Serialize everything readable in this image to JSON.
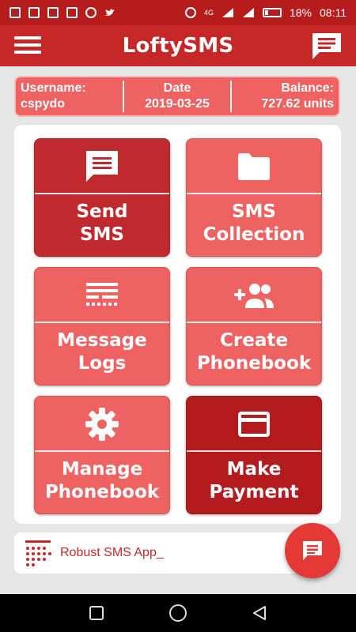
{
  "status_bar": {
    "battery": "18%",
    "time": "08:11",
    "network": "4G"
  },
  "app_bar": {
    "title": "LoftySMS",
    "menu_icon": "hamburger-menu-icon",
    "chat_icon": "chat-icon"
  },
  "info": {
    "username_label": "Username:",
    "username": "cspydo",
    "date_label": "Date",
    "date": "2019-03-25",
    "balance_label": "Balance:",
    "balance": "727.62 units"
  },
  "tiles": [
    {
      "line1": "Send",
      "line2": "SMS",
      "icon": "message-icon"
    },
    {
      "line1": "SMS",
      "line2": "Collection",
      "icon": "folder-icon"
    },
    {
      "line1": "Message",
      "line2": "Logs",
      "icon": "logs-icon"
    },
    {
      "line1": "Create",
      "line2": "Phonebook",
      "icon": "add-group-icon"
    },
    {
      "line1": "Manage",
      "line2": "Phonebook",
      "icon": "settings-gear-icon"
    },
    {
      "line1": "Make",
      "line2": "Payment",
      "icon": "credit-card-icon"
    }
  ],
  "banner": {
    "text": "Robust SMS App_",
    "icon": "dotted-grid-icon"
  },
  "colors": {
    "primary": "#c62828",
    "status_bar": "#b71c1c",
    "tile_light": "#ef6262",
    "tile_dark": "#c0292e",
    "tile_darker": "#b31b1e",
    "fab": "#e53935"
  }
}
